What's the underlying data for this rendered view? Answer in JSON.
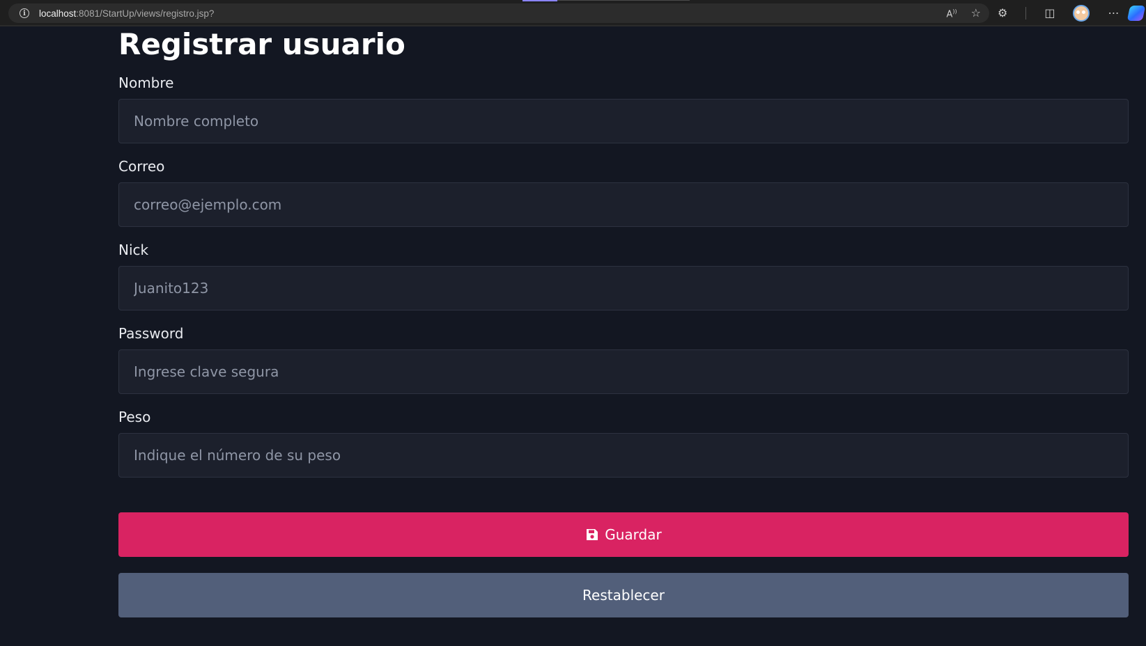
{
  "browser": {
    "url_host": "localhost",
    "url_rest": ":8081/StartUp/views/registro.jsp?"
  },
  "page": {
    "title": "Registrar usuario"
  },
  "form": {
    "fields": [
      {
        "label": "Nombre",
        "placeholder": "Nombre completo",
        "value": ""
      },
      {
        "label": "Correo",
        "placeholder": "correo@ejemplo.com",
        "value": ""
      },
      {
        "label": "Nick",
        "placeholder": "Juanito123",
        "value": ""
      },
      {
        "label": "Password",
        "placeholder": "Ingrese clave segura",
        "value": ""
      },
      {
        "label": "Peso",
        "placeholder": "Indique el número de su peso",
        "value": ""
      }
    ],
    "save_label": "Guardar",
    "reset_label": "Restablecer"
  },
  "colors": {
    "background": "#131722",
    "input_bg": "#1c202c",
    "save_button": "#d92362",
    "reset_button": "#525f7a"
  },
  "icons": {
    "save": "floppy-disk-icon"
  }
}
